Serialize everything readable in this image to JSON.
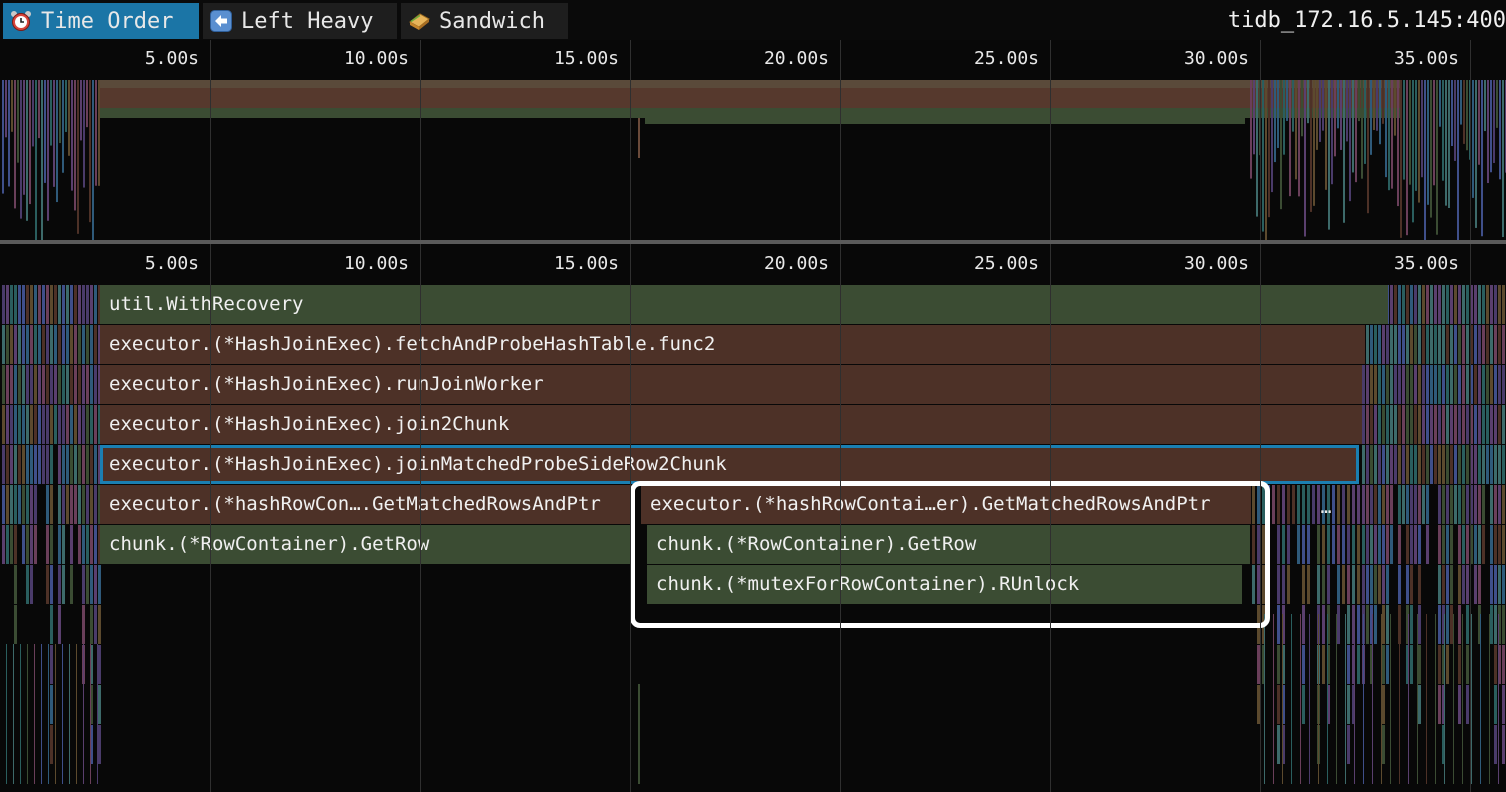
{
  "toolbar": {
    "tabs": [
      {
        "label": "Time Order",
        "icon": "alarm-clock-icon",
        "active": true
      },
      {
        "label": "Left Heavy",
        "icon": "left-arrow-icon",
        "active": false
      },
      {
        "label": "Sandwich",
        "icon": "sandwich-icon",
        "active": false
      }
    ],
    "profile_name": "tidb_172.16.5.145:400"
  },
  "time_axis": {
    "unit": "s",
    "ticks": [
      "5.00s",
      "10.00s",
      "15.00s",
      "20.00s",
      "25.00s",
      "30.00s",
      "35.00s"
    ]
  },
  "flame_frames": {
    "f0": "util.WithRecovery",
    "f1": "executor.(*HashJoinExec).fetchAndProbeHashTable.func2",
    "f2": "executor.(*HashJoinExec).runJoinWorker",
    "f3": "executor.(*HashJoinExec).join2Chunk",
    "f4": "executor.(*HashJoinExec).joinMatchedProbeSideRow2Chunk",
    "f5a": "executor.(*hashRowCon….GetMatchedRowsAndPtr",
    "f5b": "executor.(*hashRowContai…er).GetMatchedRowsAndPtr",
    "f5c": "…",
    "f6a": "chunk.(*RowContainer).GetRow",
    "f6b": "chunk.(*RowContainer).GetRow",
    "f7": "chunk.(*mutexForRowContainer).RUnlock"
  },
  "colors": {
    "active_tab": "#1b75a6",
    "frame_brown": "#4d3127",
    "frame_green": "#3b4c33",
    "selection": "#1b7fb2",
    "hover_outline": "#ffffff"
  }
}
